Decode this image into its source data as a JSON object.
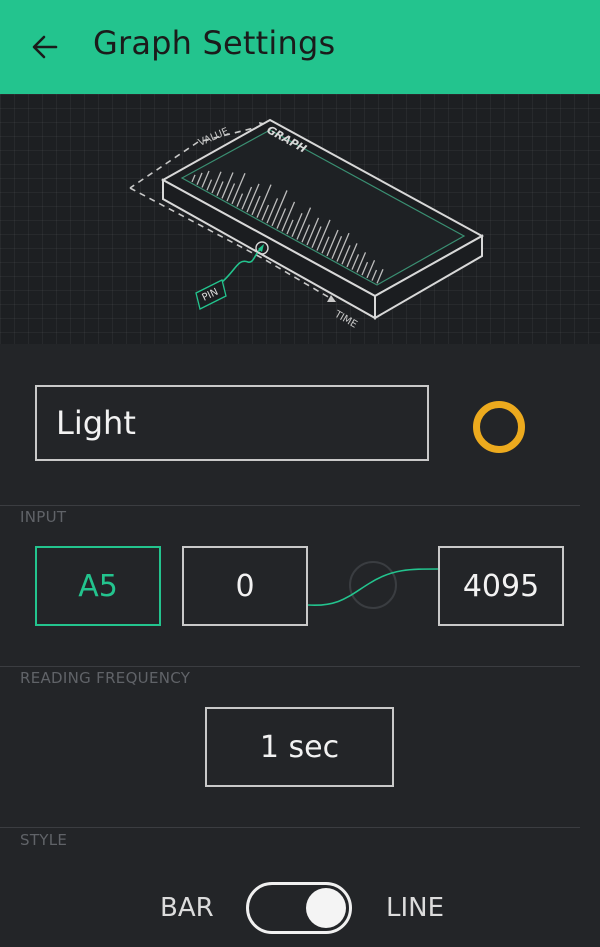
{
  "header": {
    "title": "Graph Settings",
    "back_icon": "arrow-left-icon",
    "color": "#23c48e"
  },
  "illustration": {
    "graph_label": "GRAPH",
    "value_label": "VALUE",
    "time_label": "TIME",
    "pin_label": "PIN"
  },
  "name_field": {
    "value": "Light"
  },
  "color_picker": {
    "color": "#ecaa1e"
  },
  "input": {
    "section_label": "INPUT",
    "pin": "A5",
    "min": "0",
    "max": "4095"
  },
  "reading_frequency": {
    "section_label": "READING FREQUENCY",
    "value": "1 sec"
  },
  "style": {
    "section_label": "STYLE",
    "left_option": "BAR",
    "right_option": "LINE",
    "selected": "LINE"
  }
}
